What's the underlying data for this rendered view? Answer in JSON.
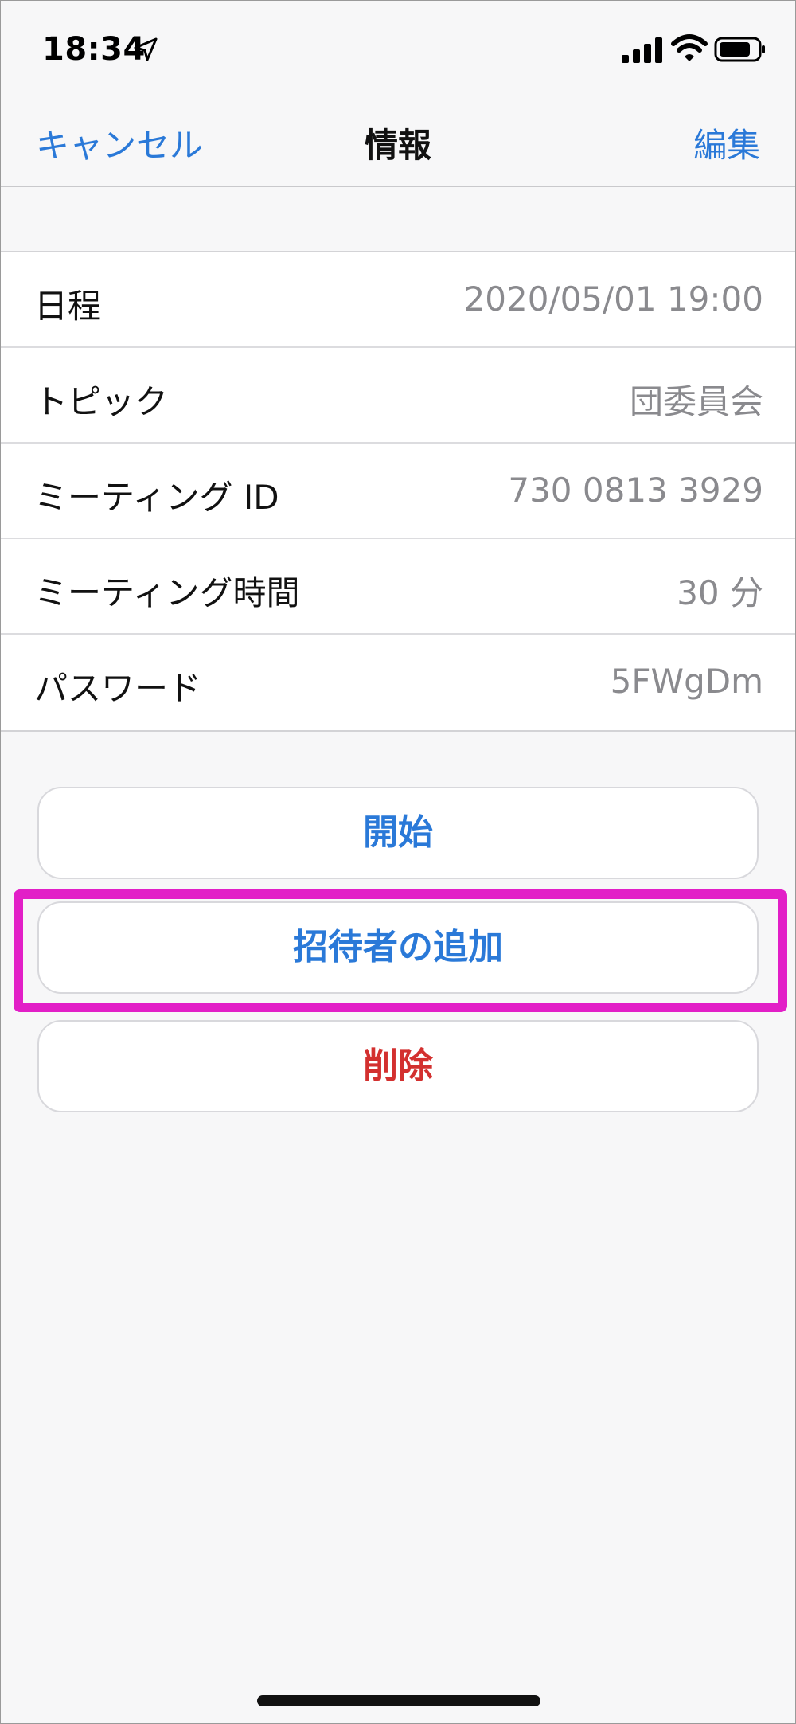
{
  "status_bar": {
    "time": "18:34",
    "icons": [
      "location-arrow-icon",
      "cellular-signal-icon",
      "wifi-icon",
      "battery-icon"
    ]
  },
  "nav": {
    "cancel_label": "キャンセル",
    "title": "情報",
    "edit_label": "編集"
  },
  "info": {
    "rows": [
      {
        "label": "日程",
        "value": "2020/05/01 19:00"
      },
      {
        "label": "トピック",
        "value": "団委員会"
      },
      {
        "label": "ミーティング ID",
        "value": "730 0813 3929"
      },
      {
        "label": "ミーティング時間",
        "value": "30 分"
      },
      {
        "label": "パスワード",
        "value": "5FWgDm"
      }
    ]
  },
  "actions": {
    "start_label": "開始",
    "invite_label": "招待者の追加",
    "delete_label": "削除"
  },
  "colors": {
    "accent": "#2a79d8",
    "destructive": "#d3302f",
    "highlight": "#e21fc7",
    "background": "#f7f7f8"
  }
}
